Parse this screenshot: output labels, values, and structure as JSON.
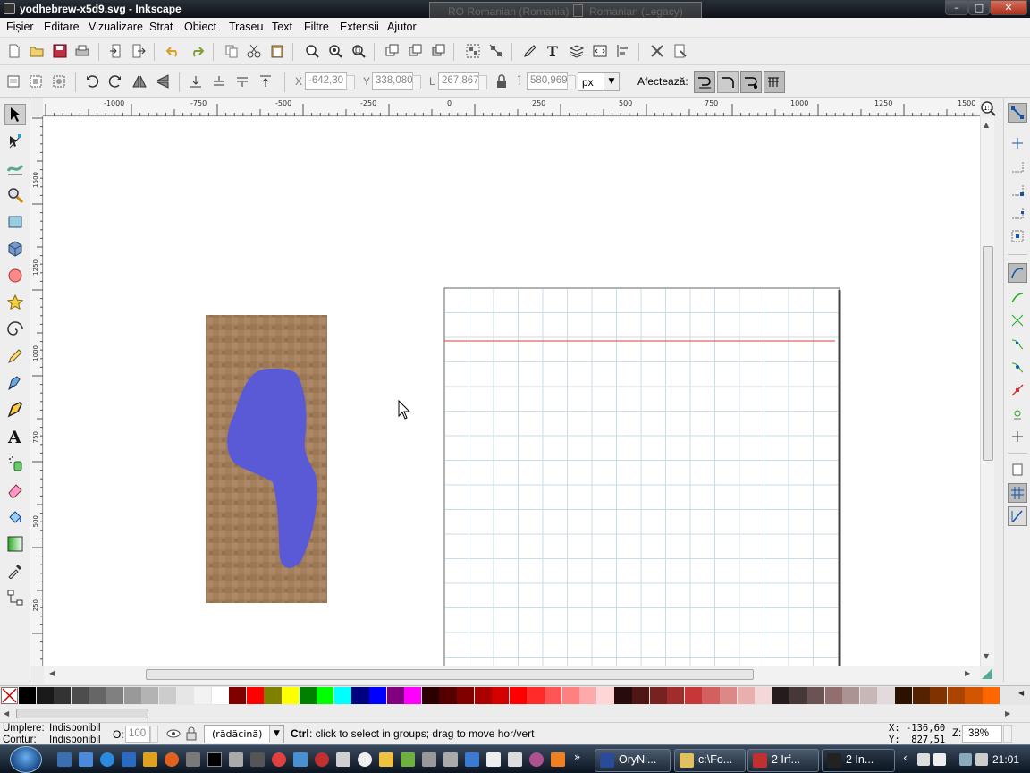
{
  "window": {
    "title": "yodhebrew-x5d9.svg - Inkscape",
    "controls": {
      "minimize": "–",
      "maximize": "□",
      "close": "✕"
    }
  },
  "language_bar": {
    "left": "RO Romanian (Romania)",
    "right": "Romanian (Legacy)"
  },
  "menu": [
    "Fișier",
    "Editare",
    "Vizualizare",
    "Strat",
    "Obiect",
    "Traseu",
    "Text",
    "Filtre",
    "Extensii",
    "Ajutor"
  ],
  "controls_bar": {
    "x_label": "X",
    "x_value": "-642,30",
    "y_label": "Y",
    "y_value": "338,080",
    "w_label": "L",
    "w_value": "267,867",
    "h_label": "Î",
    "h_value": "580,969",
    "unit": "px",
    "affect_label": "Afectează:"
  },
  "ruler": {
    "h_labels": [
      "-1000",
      "-750",
      "-500",
      "-250",
      "0",
      "250",
      "500",
      "750",
      "1000",
      "1250",
      "1500"
    ],
    "v_labels": [
      "1500",
      "1250",
      "1000",
      "750",
      "500",
      "250"
    ]
  },
  "statusbar": {
    "fill_label": "Umplere:",
    "fill_value": "Indisponibil",
    "stroke_label": "Contur:",
    "stroke_value": "Indisponibil",
    "opacity_label": "O:",
    "opacity_value": "100",
    "layer": "(rădăcină)",
    "hint_key": "Ctrl",
    "hint_text": ": click to select in groups; drag to move hor/vert",
    "cursor_x": "X: -136,60",
    "cursor_y": "Y:  827,51",
    "zoom_label": "Z:",
    "zoom_value": "38%"
  },
  "taskbar": {
    "items": [
      "OryNi...",
      "c:\\Fo...",
      "2 Irf...",
      "2 In..."
    ],
    "clock": "21:01"
  },
  "colors": {
    "accent": "#5a5adb",
    "canvas_guide": "#e33b3b",
    "grid": "#c9dde6"
  },
  "palette": [
    "#000000",
    "#1a1a1a",
    "#333333",
    "#4d4d4d",
    "#666666",
    "#808080",
    "#999999",
    "#b3b3b3",
    "#cccccc",
    "#e6e6e6",
    "#f2f2f2",
    "#ffffff",
    "#800000",
    "#ff0000",
    "#808000",
    "#ffff00",
    "#008000",
    "#00ff00",
    "#00ffff",
    "#000080",
    "#0000ff",
    "#800080",
    "#ff00ff",
    "#2b0000",
    "#550000",
    "#800000",
    "#aa0000",
    "#d40000",
    "#ff0000",
    "#ff2a2a",
    "#ff5555",
    "#ff8080",
    "#ffaaaa",
    "#ffd5d5",
    "#280b0b",
    "#501616",
    "#782121",
    "#a02c2c",
    "#c83737",
    "#d35f5f",
    "#de8787",
    "#e9afaf",
    "#f4d7d7",
    "#241c1c",
    "#483737",
    "#6c5353",
    "#916f6f",
    "#ac9393",
    "#c8b7b7",
    "#e3dbdb",
    "#2b1100",
    "#552200",
    "#803300",
    "#aa4400",
    "#d45500",
    "#ff6600"
  ]
}
